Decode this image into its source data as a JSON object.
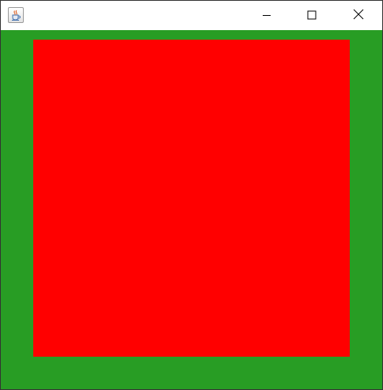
{
  "window": {
    "title": "",
    "app_icon": "java-coffee-cup-icon",
    "controls": {
      "minimize_icon": "minimize-icon",
      "maximize_icon": "maximize-icon",
      "close_icon": "close-icon"
    }
  },
  "canvas": {
    "background_color": "#289D24",
    "square_color": "#FF0000"
  }
}
